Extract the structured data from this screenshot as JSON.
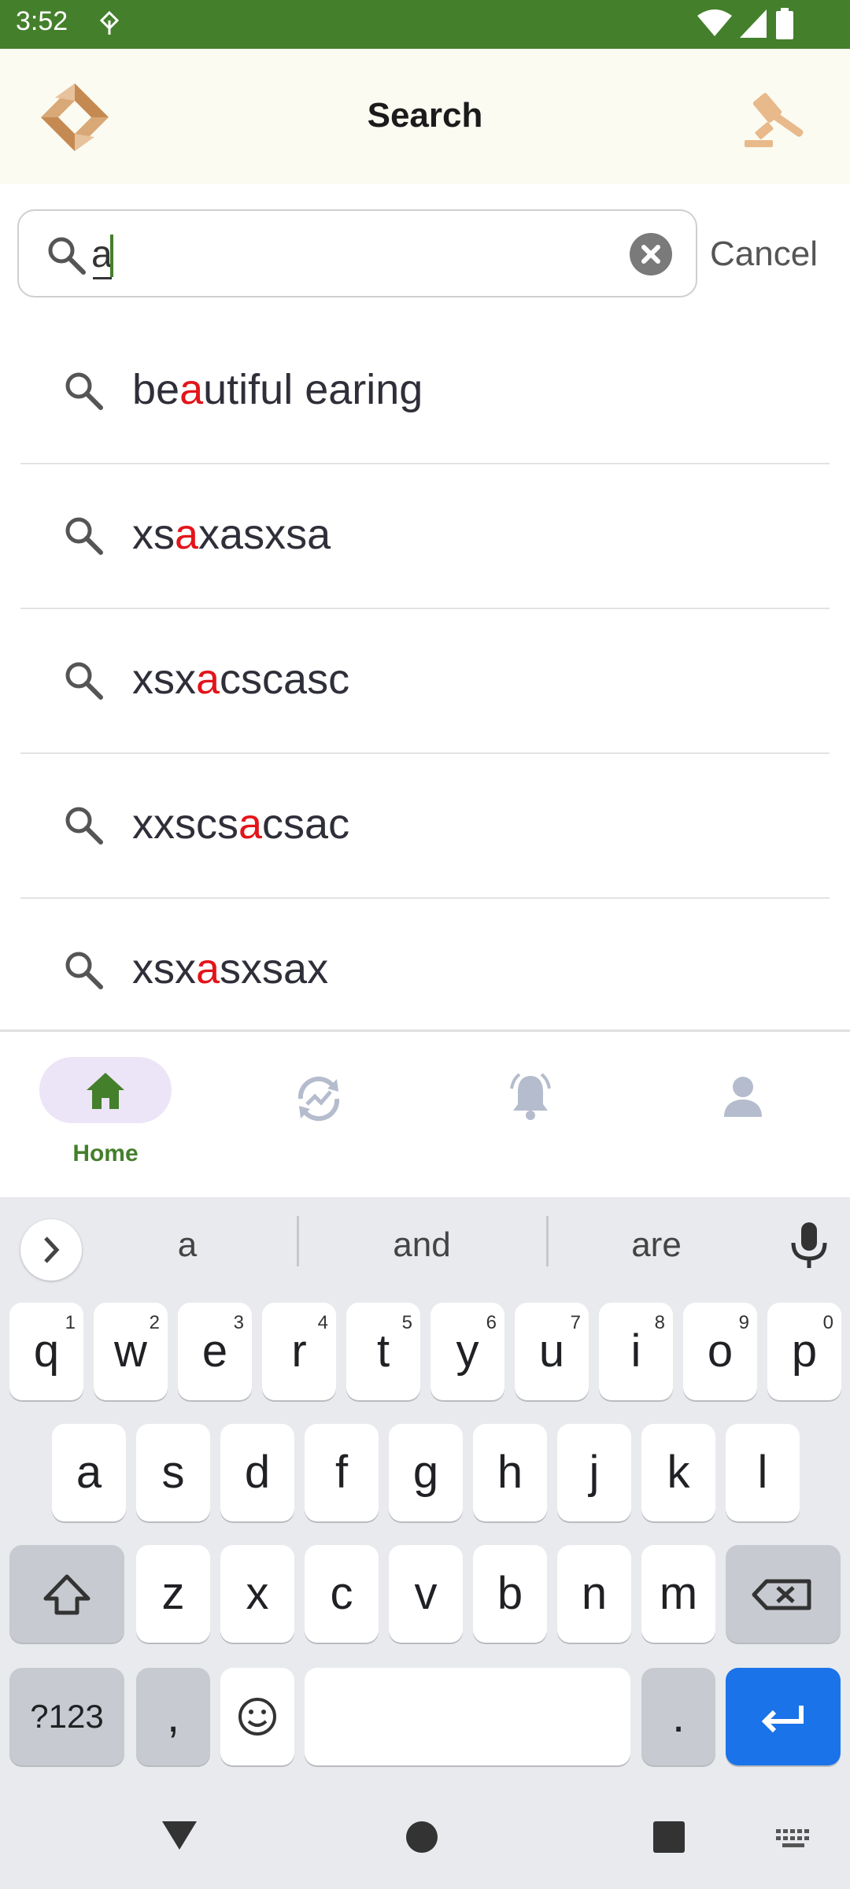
{
  "status_bar": {
    "time": "3:52"
  },
  "app_bar": {
    "title": "Search"
  },
  "search": {
    "value": "a",
    "cancel_label": "Cancel"
  },
  "suggestions": [
    {
      "before": "be",
      "match": "a",
      "after": "utiful earing"
    },
    {
      "before": "xs",
      "match": "a",
      "after": "xasxsa"
    },
    {
      "before": "xsx",
      "match": "a",
      "after": "cscasc"
    },
    {
      "before": "xxscs",
      "match": "a",
      "after": "csac"
    },
    {
      "before": "xsx",
      "match": "a",
      "after": "sxsax"
    }
  ],
  "bottom_nav": {
    "home_label": "Home"
  },
  "keyboard": {
    "suggestions": [
      "a",
      "and",
      "are"
    ],
    "row1": [
      {
        "key": "q",
        "hint": "1"
      },
      {
        "key": "w",
        "hint": "2"
      },
      {
        "key": "e",
        "hint": "3"
      },
      {
        "key": "r",
        "hint": "4"
      },
      {
        "key": "t",
        "hint": "5"
      },
      {
        "key": "y",
        "hint": "6"
      },
      {
        "key": "u",
        "hint": "7"
      },
      {
        "key": "i",
        "hint": "8"
      },
      {
        "key": "o",
        "hint": "9"
      },
      {
        "key": "p",
        "hint": "0"
      }
    ],
    "row2": [
      "a",
      "s",
      "d",
      "f",
      "g",
      "h",
      "j",
      "k",
      "l"
    ],
    "row3": [
      "z",
      "x",
      "c",
      "v",
      "b",
      "n",
      "m"
    ],
    "symbols_label": "?123",
    "comma_label": ",",
    "period_label": "."
  },
  "colors": {
    "accent": "#447f2b",
    "highlight": "#e3141a",
    "enter": "#1a73e8"
  },
  "icons": [
    "logo-icon",
    "gavel-icon",
    "search-icon",
    "clear-icon",
    "home-icon",
    "activity-icon",
    "bell-icon",
    "profile-icon",
    "mic-icon",
    "shift-icon",
    "backspace-icon",
    "emoji-icon",
    "enter-icon"
  ]
}
